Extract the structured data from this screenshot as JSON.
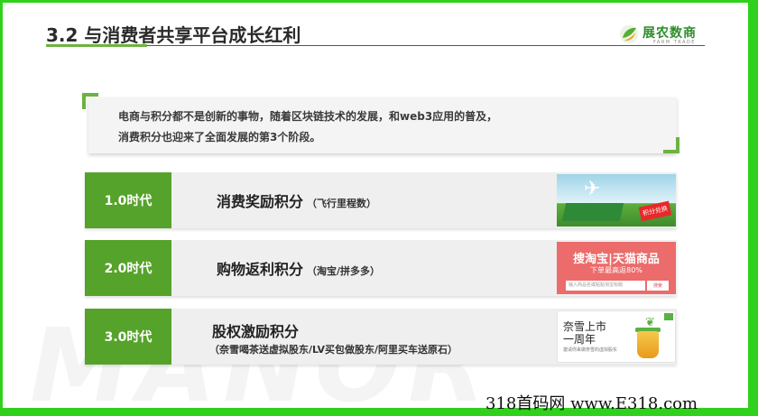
{
  "header": {
    "title": "3.2 与消费者共享平台成长红利",
    "logo_name": "展农数商",
    "logo_sub": "FARM TRADE"
  },
  "intro": {
    "line1": "电商与积分都不是创新的事物，随着区块链技术的发展，和web3应用的普及，",
    "line2": "消费积分也迎来了全面发展的第3个阶段。"
  },
  "eras": [
    {
      "label": "1.0时代",
      "title": "消费奖励积分",
      "note": "（飞行里程数）",
      "thumb_badge": "积分兑换"
    },
    {
      "label": "2.0时代",
      "title": "购物返利积分",
      "note": "（淘宝/拼多多）",
      "thumb_brand": "搜淘宝|天猫商品",
      "thumb_promo": "下单最高返80%",
      "thumb_search_placeholder": "输入商品名或粘贴淘宝标题",
      "thumb_search_btn": "搜索"
    },
    {
      "label": "3.0时代",
      "title": "股权激励积分",
      "sub": "（奈雪喝茶送虚拟股东/LV买包做股东/阿里买车送原石）",
      "thumb_line1": "奈雪上市",
      "thumb_line2": "一周年",
      "thumb_small": "邀请你来做奈雪的虚拟股东"
    }
  ],
  "background": {
    "watermark": "MANOR",
    "site_mark": "318首码网 www.E318.com"
  },
  "colors": {
    "accent_green": "#55a32a",
    "border_green": "#2fd11c",
    "logo_green": "#2f8d2c"
  }
}
